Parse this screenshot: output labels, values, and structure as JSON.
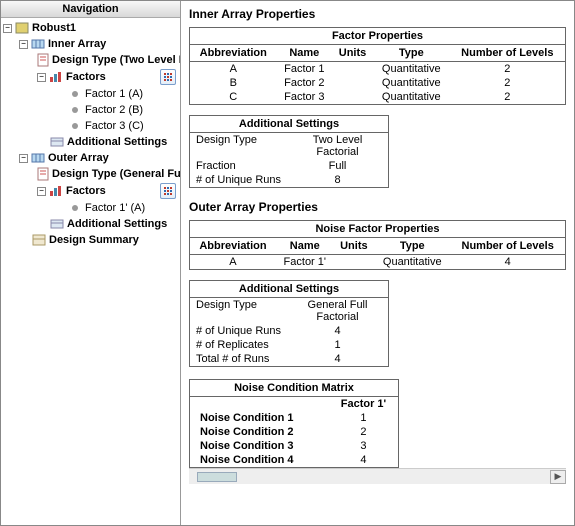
{
  "nav": {
    "title": "Navigation",
    "root": "Robust1",
    "inner": "Inner Array",
    "inner_design": "Design Type (Two Level Factorial)",
    "factors": "Factors",
    "factor1": "Factor 1 (A)",
    "factor2": "Factor 2 (B)",
    "factor3": "Factor 3 (C)",
    "addl": "Additional Settings",
    "outer": "Outer Array",
    "outer_design": "Design Type (General Full Factorial)",
    "outer_factor1": "Factor 1' (A)",
    "summary": "Design Summary"
  },
  "content": {
    "inner_title": "Inner Array Properties",
    "outer_title": "Outer Array Properties",
    "factor_props_title": "Factor Properties",
    "noise_factor_props_title": "Noise Factor Properties",
    "addl_title": "Additional Settings",
    "ncm_title": "Noise Condition Matrix",
    "cols": {
      "abbrev": "Abbreviation",
      "name": "Name",
      "units": "Units",
      "type": "Type",
      "levels": "Number of Levels"
    },
    "inner_factors": [
      {
        "abbrev": "A",
        "name": "Factor 1",
        "units": "",
        "type": "Quantitative",
        "levels": "2"
      },
      {
        "abbrev": "B",
        "name": "Factor 2",
        "units": "",
        "type": "Quantitative",
        "levels": "2"
      },
      {
        "abbrev": "C",
        "name": "Factor 3",
        "units": "",
        "type": "Quantitative",
        "levels": "2"
      }
    ],
    "inner_settings": [
      {
        "label": "Design Type",
        "value": "Two Level Factorial"
      },
      {
        "label": "Fraction",
        "value": "Full"
      },
      {
        "label": "# of Unique Runs",
        "value": "8"
      }
    ],
    "outer_factors": [
      {
        "abbrev": "A",
        "name": "Factor 1'",
        "units": "",
        "type": "Quantitative",
        "levels": "4"
      }
    ],
    "outer_settings": [
      {
        "label": "Design Type",
        "value": "General Full Factorial"
      },
      {
        "label": "# of Unique Runs",
        "value": "4"
      },
      {
        "label": "# of Replicates",
        "value": "1"
      },
      {
        "label": "Total # of Runs",
        "value": "4"
      }
    ],
    "ncm_header": "Factor 1'",
    "ncm_rows": [
      {
        "name": "Noise Condition 1",
        "value": "1"
      },
      {
        "name": "Noise Condition 2",
        "value": "2"
      },
      {
        "name": "Noise Condition 3",
        "value": "3"
      },
      {
        "name": "Noise Condition 4",
        "value": "4"
      }
    ]
  }
}
